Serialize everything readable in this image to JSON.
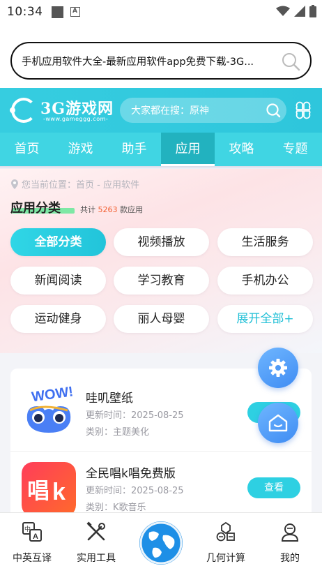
{
  "status_bar": {
    "time": "10:34"
  },
  "browser": {
    "url_text": "手机应用软件大全-最新应用软件app免费下载-3G..."
  },
  "site": {
    "logo_text": "3G游戏网",
    "logo_sub": "-www.gameggg.com-",
    "search_placeholder": "大家都在搜：原神"
  },
  "nav": {
    "tabs": [
      {
        "label": "首页"
      },
      {
        "label": "游戏"
      },
      {
        "label": "助手"
      },
      {
        "label": "应用"
      },
      {
        "label": "攻略"
      },
      {
        "label": "专题"
      }
    ],
    "active_index": 3
  },
  "category": {
    "breadcrumb": "您当前位置：首页 - 应用软件",
    "title": "应用分类",
    "count_prefix": "共计",
    "count_num": "5263",
    "count_suffix": "款应用",
    "buttons": [
      {
        "label": "全部分类"
      },
      {
        "label": "视频播放"
      },
      {
        "label": "生活服务"
      },
      {
        "label": "新闻阅读"
      },
      {
        "label": "学习教育"
      },
      {
        "label": "手机办公"
      },
      {
        "label": "运动健身"
      },
      {
        "label": "丽人母婴"
      },
      {
        "label": "展开全部+"
      }
    ]
  },
  "apps": [
    {
      "name": "哇叽壁纸",
      "updated": "更新时间：2025-08-25",
      "category": "类别：主题美化",
      "button": "查看",
      "icon": "wow-icon"
    },
    {
      "name": "全民唱k唱免费版",
      "updated": "更新时间：2025-08-25",
      "category": "类别：K歌音乐",
      "button": "查看",
      "icon": "karaoke-icon"
    }
  ],
  "bottom_nav": [
    {
      "label": "中英互译",
      "icon": "translate-icon"
    },
    {
      "label": "实用工具",
      "icon": "tools-icon"
    },
    {
      "label": "",
      "icon": "globe-icon"
    },
    {
      "label": "几何计算",
      "icon": "geometry-icon"
    },
    {
      "label": "我的",
      "icon": "profile-icon"
    }
  ],
  "colors": {
    "accent": "#36cde0",
    "nav_active": "#22b2bf",
    "count_highlight": "#f25c2c",
    "fab_blue": "#3f8cf3"
  }
}
